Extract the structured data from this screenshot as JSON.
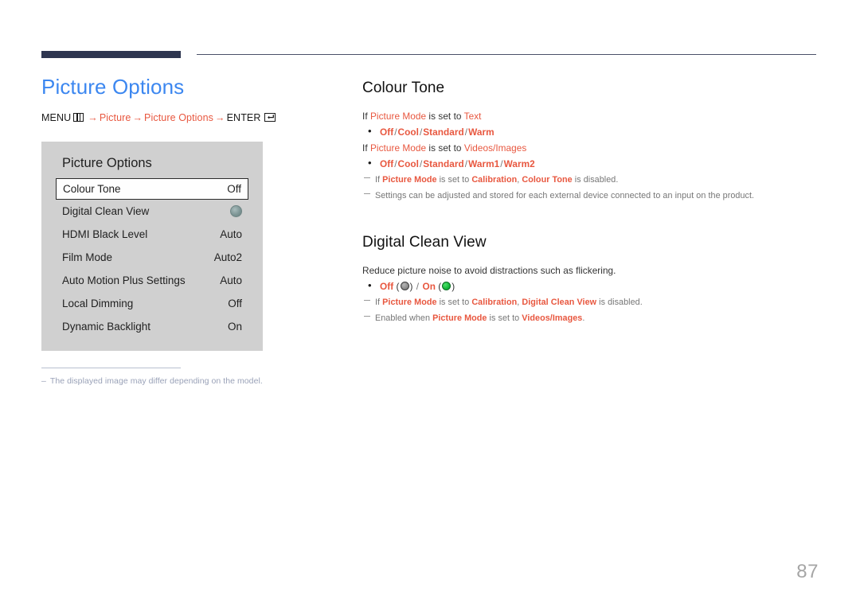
{
  "page": {
    "number": "87",
    "title": "Picture Options",
    "title_color": "#3c87f0",
    "accent_color": "#e8573f",
    "rule_color": "#2e3650"
  },
  "menu_path": {
    "prefix": "MENU",
    "menu_icon": "menu-grid-icon",
    "steps": [
      "Picture",
      "Picture Options"
    ],
    "arrow": "→",
    "enter_label": "ENTER",
    "enter_icon": "enter-return-icon"
  },
  "osd": {
    "title": "Picture Options",
    "rows": [
      {
        "label": "Colour Tone",
        "value": "Off",
        "selected": true,
        "type": "text"
      },
      {
        "label": "Digital Clean View",
        "value": "",
        "selected": false,
        "type": "toggle"
      },
      {
        "label": "HDMI Black Level",
        "value": "Auto",
        "selected": false,
        "type": "text"
      },
      {
        "label": "Film Mode",
        "value": "Auto2",
        "selected": false,
        "type": "text"
      },
      {
        "label": "Auto Motion Plus Settings",
        "value": "Auto",
        "selected": false,
        "type": "text"
      },
      {
        "label": "Local Dimming",
        "value": "Off",
        "selected": false,
        "type": "text"
      },
      {
        "label": "Dynamic Backlight",
        "value": "On",
        "selected": false,
        "type": "text"
      }
    ]
  },
  "left_footnote": {
    "dash": "–",
    "text": "The displayed image may differ depending on the model."
  },
  "sections": [
    {
      "heading": "Colour Tone",
      "lines": [
        {
          "kind": "body",
          "parts": [
            {
              "t": "If ",
              "hl": false
            },
            {
              "t": "Picture Mode",
              "hl": true
            },
            {
              "t": " is set to ",
              "hl": false
            },
            {
              "t": "Text",
              "hl": true
            }
          ]
        },
        {
          "kind": "bullet",
          "options": [
            "Off",
            "Cool",
            "Standard",
            "Warm"
          ],
          "sep": "/"
        },
        {
          "kind": "body",
          "parts": [
            {
              "t": "If ",
              "hl": false
            },
            {
              "t": "Picture Mode",
              "hl": true
            },
            {
              "t": " is set to ",
              "hl": false
            },
            {
              "t": "Videos/Images",
              "hl": true
            }
          ]
        },
        {
          "kind": "bullet",
          "options": [
            "Off",
            "Cool",
            "Standard",
            "Warm1",
            "Warm2"
          ],
          "sep": "/"
        },
        {
          "kind": "note",
          "parts": [
            {
              "t": "If ",
              "hl": false
            },
            {
              "t": "Picture Mode",
              "hl": true
            },
            {
              "t": " is set to ",
              "hl": false
            },
            {
              "t": "Calibration",
              "hl": true
            },
            {
              "t": ", ",
              "hl": false
            },
            {
              "t": "Colour Tone",
              "hl": true
            },
            {
              "t": " is disabled.",
              "hl": false
            }
          ]
        },
        {
          "kind": "note",
          "parts": [
            {
              "t": "Settings can be adjusted and stored for each external device connected to an input on the product.",
              "hl": false
            }
          ]
        }
      ]
    },
    {
      "heading": "Digital Clean View",
      "lines": [
        {
          "kind": "body",
          "parts": [
            {
              "t": "Reduce picture noise to avoid distractions such as flickering.",
              "hl": false
            }
          ]
        },
        {
          "kind": "bullet-switch",
          "off_label": "Off",
          "on_label": "On",
          "sep": "/",
          "off_swatch": "#8e8e8e",
          "on_swatch": "#17b93d"
        },
        {
          "kind": "note",
          "parts": [
            {
              "t": "If ",
              "hl": false
            },
            {
              "t": "Picture Mode",
              "hl": true
            },
            {
              "t": " is set to ",
              "hl": false
            },
            {
              "t": "Calibration",
              "hl": true
            },
            {
              "t": ", ",
              "hl": false
            },
            {
              "t": "Digital Clean View",
              "hl": true
            },
            {
              "t": " is disabled.",
              "hl": false
            }
          ]
        },
        {
          "kind": "note",
          "parts": [
            {
              "t": "Enabled when ",
              "hl": false
            },
            {
              "t": "Picture Mode",
              "hl": true
            },
            {
              "t": " is set to ",
              "hl": false
            },
            {
              "t": "Videos/Images",
              "hl": true
            },
            {
              "t": ".",
              "hl": false
            }
          ]
        }
      ]
    }
  ]
}
